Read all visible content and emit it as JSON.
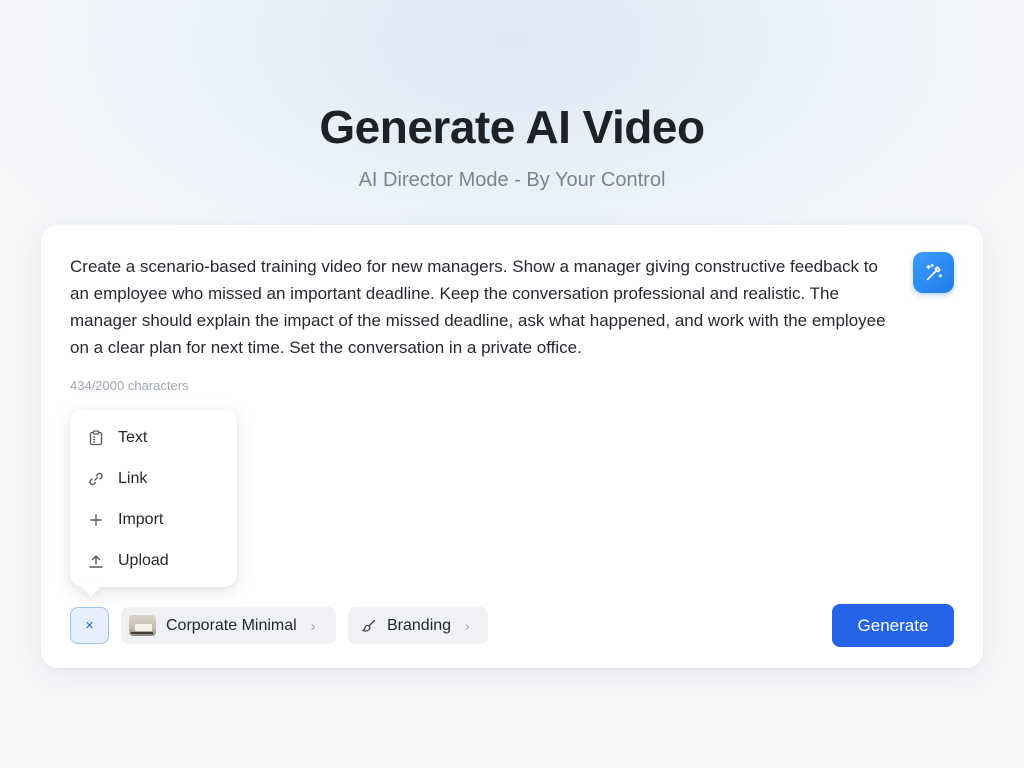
{
  "header": {
    "title": "Generate AI Video",
    "subtitle": "AI Director Mode - By Your Control"
  },
  "prompt": {
    "text": "Create a scenario-based training video for new managers. Show a manager giving constructive feedback to an employee who missed an important deadline. Keep the conversation professional and realistic. The manager should explain the impact of the missed deadline, ask what happened, and work with the employee on a clear plan for next time. Set the conversation in a private office.",
    "char_count": "434/2000 characters",
    "enhance_icon": "magic-wand-icon"
  },
  "menu": {
    "items": [
      {
        "label": "Text",
        "icon": "clipboard-icon"
      },
      {
        "label": "Link",
        "icon": "link-icon"
      },
      {
        "label": "Import",
        "icon": "plus-icon"
      },
      {
        "label": "Upload",
        "icon": "upload-icon"
      }
    ]
  },
  "toolbar": {
    "close_label": "×",
    "style_chip": {
      "label": "Corporate Minimal"
    },
    "branding_chip": {
      "label": "Branding"
    },
    "generate_label": "Generate"
  },
  "colors": {
    "accent": "#2563e8",
    "enhance_button": "#2a8cf5"
  }
}
